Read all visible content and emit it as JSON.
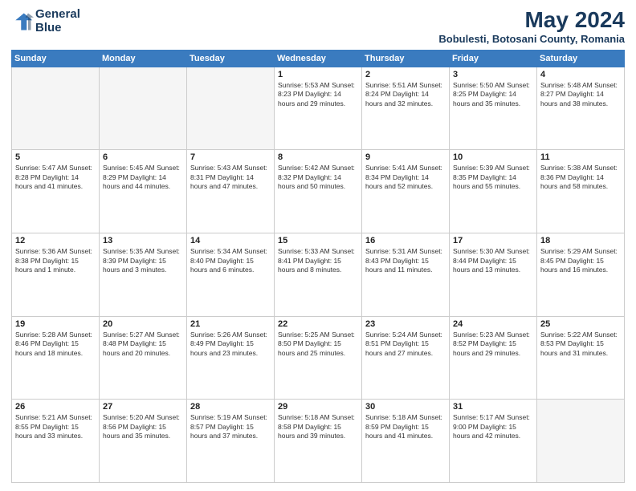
{
  "header": {
    "logo_line1": "General",
    "logo_line2": "Blue",
    "title": "May 2024",
    "subtitle": "Bobulesti, Botosani County, Romania"
  },
  "days_of_week": [
    "Sunday",
    "Monday",
    "Tuesday",
    "Wednesday",
    "Thursday",
    "Friday",
    "Saturday"
  ],
  "weeks": [
    [
      {
        "day": "",
        "info": ""
      },
      {
        "day": "",
        "info": ""
      },
      {
        "day": "",
        "info": ""
      },
      {
        "day": "1",
        "info": "Sunrise: 5:53 AM\nSunset: 8:23 PM\nDaylight: 14 hours\nand 29 minutes."
      },
      {
        "day": "2",
        "info": "Sunrise: 5:51 AM\nSunset: 8:24 PM\nDaylight: 14 hours\nand 32 minutes."
      },
      {
        "day": "3",
        "info": "Sunrise: 5:50 AM\nSunset: 8:25 PM\nDaylight: 14 hours\nand 35 minutes."
      },
      {
        "day": "4",
        "info": "Sunrise: 5:48 AM\nSunset: 8:27 PM\nDaylight: 14 hours\nand 38 minutes."
      }
    ],
    [
      {
        "day": "5",
        "info": "Sunrise: 5:47 AM\nSunset: 8:28 PM\nDaylight: 14 hours\nand 41 minutes."
      },
      {
        "day": "6",
        "info": "Sunrise: 5:45 AM\nSunset: 8:29 PM\nDaylight: 14 hours\nand 44 minutes."
      },
      {
        "day": "7",
        "info": "Sunrise: 5:43 AM\nSunset: 8:31 PM\nDaylight: 14 hours\nand 47 minutes."
      },
      {
        "day": "8",
        "info": "Sunrise: 5:42 AM\nSunset: 8:32 PM\nDaylight: 14 hours\nand 50 minutes."
      },
      {
        "day": "9",
        "info": "Sunrise: 5:41 AM\nSunset: 8:34 PM\nDaylight: 14 hours\nand 52 minutes."
      },
      {
        "day": "10",
        "info": "Sunrise: 5:39 AM\nSunset: 8:35 PM\nDaylight: 14 hours\nand 55 minutes."
      },
      {
        "day": "11",
        "info": "Sunrise: 5:38 AM\nSunset: 8:36 PM\nDaylight: 14 hours\nand 58 minutes."
      }
    ],
    [
      {
        "day": "12",
        "info": "Sunrise: 5:36 AM\nSunset: 8:38 PM\nDaylight: 15 hours\nand 1 minute."
      },
      {
        "day": "13",
        "info": "Sunrise: 5:35 AM\nSunset: 8:39 PM\nDaylight: 15 hours\nand 3 minutes."
      },
      {
        "day": "14",
        "info": "Sunrise: 5:34 AM\nSunset: 8:40 PM\nDaylight: 15 hours\nand 6 minutes."
      },
      {
        "day": "15",
        "info": "Sunrise: 5:33 AM\nSunset: 8:41 PM\nDaylight: 15 hours\nand 8 minutes."
      },
      {
        "day": "16",
        "info": "Sunrise: 5:31 AM\nSunset: 8:43 PM\nDaylight: 15 hours\nand 11 minutes."
      },
      {
        "day": "17",
        "info": "Sunrise: 5:30 AM\nSunset: 8:44 PM\nDaylight: 15 hours\nand 13 minutes."
      },
      {
        "day": "18",
        "info": "Sunrise: 5:29 AM\nSunset: 8:45 PM\nDaylight: 15 hours\nand 16 minutes."
      }
    ],
    [
      {
        "day": "19",
        "info": "Sunrise: 5:28 AM\nSunset: 8:46 PM\nDaylight: 15 hours\nand 18 minutes."
      },
      {
        "day": "20",
        "info": "Sunrise: 5:27 AM\nSunset: 8:48 PM\nDaylight: 15 hours\nand 20 minutes."
      },
      {
        "day": "21",
        "info": "Sunrise: 5:26 AM\nSunset: 8:49 PM\nDaylight: 15 hours\nand 23 minutes."
      },
      {
        "day": "22",
        "info": "Sunrise: 5:25 AM\nSunset: 8:50 PM\nDaylight: 15 hours\nand 25 minutes."
      },
      {
        "day": "23",
        "info": "Sunrise: 5:24 AM\nSunset: 8:51 PM\nDaylight: 15 hours\nand 27 minutes."
      },
      {
        "day": "24",
        "info": "Sunrise: 5:23 AM\nSunset: 8:52 PM\nDaylight: 15 hours\nand 29 minutes."
      },
      {
        "day": "25",
        "info": "Sunrise: 5:22 AM\nSunset: 8:53 PM\nDaylight: 15 hours\nand 31 minutes."
      }
    ],
    [
      {
        "day": "26",
        "info": "Sunrise: 5:21 AM\nSunset: 8:55 PM\nDaylight: 15 hours\nand 33 minutes."
      },
      {
        "day": "27",
        "info": "Sunrise: 5:20 AM\nSunset: 8:56 PM\nDaylight: 15 hours\nand 35 minutes."
      },
      {
        "day": "28",
        "info": "Sunrise: 5:19 AM\nSunset: 8:57 PM\nDaylight: 15 hours\nand 37 minutes."
      },
      {
        "day": "29",
        "info": "Sunrise: 5:18 AM\nSunset: 8:58 PM\nDaylight: 15 hours\nand 39 minutes."
      },
      {
        "day": "30",
        "info": "Sunrise: 5:18 AM\nSunset: 8:59 PM\nDaylight: 15 hours\nand 41 minutes."
      },
      {
        "day": "31",
        "info": "Sunrise: 5:17 AM\nSunset: 9:00 PM\nDaylight: 15 hours\nand 42 minutes."
      },
      {
        "day": "",
        "info": ""
      }
    ]
  ]
}
